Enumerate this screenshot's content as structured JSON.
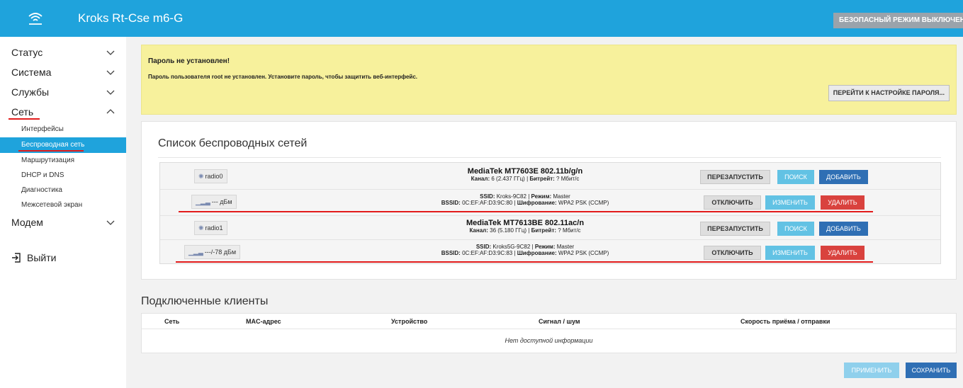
{
  "header": {
    "title": "Kroks Rt-Cse m6-G",
    "safe_mode": "БЕЗОПАСНЫЙ РЕЖИМ ВЫКЛЮЧЕН",
    "logo_icon": "wifi-signal-icon"
  },
  "sidebar": {
    "items": [
      {
        "label": "Статус",
        "icon": "chevron-down-icon"
      },
      {
        "label": "Система",
        "icon": "chevron-down-icon"
      },
      {
        "label": "Службы",
        "icon": "chevron-down-icon"
      },
      {
        "label": "Сеть",
        "icon": "chevron-up-icon"
      }
    ],
    "subitems": [
      {
        "label": "Интерфейсы"
      },
      {
        "label": "Беспроводная сеть"
      },
      {
        "label": "Маршрутизация"
      },
      {
        "label": "DHCP и DNS"
      },
      {
        "label": "Диагностика"
      },
      {
        "label": "Межсетевой экран"
      }
    ],
    "modem": {
      "label": "Модем"
    },
    "logout": {
      "label": "Выйти",
      "icon": "logout-icon"
    }
  },
  "warning": {
    "title": "Пароль не установлен!",
    "text": "Пароль пользователя root не установлен. Установите пароль, чтобы защитить веб-интерфейс.",
    "button": "ПЕРЕЙТИ К НАСТРОЙКЕ ПАРОЛЯ..."
  },
  "wireless": {
    "title": "Список беспроводных сетей",
    "devices": [
      {
        "radio_label": "radio0",
        "name": "MediaTek MT7603E 802.11b/g/n",
        "channel_label": "Канал:",
        "channel_value": "6 (2.437 ГГц)",
        "bitrate_label": "Битрейт:",
        "bitrate_value": "? Мбит/с",
        "btn_restart": "ПЕРЕЗАПУСТИТЬ",
        "btn_search": "ПОИСК",
        "btn_add": "ДОБАВИТЬ",
        "signal_label": "--- дБм",
        "ssid_label": "SSID:",
        "ssid_value": "Kroks-9C82",
        "mode_label": "Режим:",
        "mode_value": "Master",
        "bssid_label": "BSSID:",
        "bssid_value": "0C:EF:AF:D3:9C:80",
        "enc_label": "Шифрование:",
        "enc_value": "WPA2 PSK (CCMP)",
        "btn_disable": "ОТКЛЮЧИТЬ",
        "btn_edit": "ИЗМЕНИТЬ",
        "btn_delete": "УДАЛИТЬ"
      },
      {
        "radio_label": "radio1",
        "name": "MediaTek MT7613BE 802.11ac/n",
        "channel_label": "Канал:",
        "channel_value": "36 (5.180 ГГц)",
        "bitrate_label": "Битрейт:",
        "bitrate_value": "? Мбит/с",
        "btn_restart": "ПЕРЕЗАПУСТИТЬ",
        "btn_search": "ПОИСК",
        "btn_add": "ДОБАВИТЬ",
        "signal_label": "---/-78 дБм",
        "ssid_label": "SSID:",
        "ssid_value": "Kroks5G-9C82",
        "mode_label": "Режим:",
        "mode_value": "Master",
        "bssid_label": "BSSID:",
        "bssid_value": "0C:EF:AF:D3:9C:83",
        "enc_label": "Шифрование:",
        "enc_value": "WPA2 PSK (CCMP)",
        "btn_disable": "ОТКЛЮЧИТЬ",
        "btn_edit": "ИЗМЕНИТЬ",
        "btn_delete": "УДАЛИТЬ"
      }
    ]
  },
  "clients": {
    "title": "Подключенные клиенты",
    "columns": [
      "Сеть",
      "MAC-адрес",
      "Устройство",
      "Сигнал / шум",
      "Скорость приёма / отправки"
    ],
    "empty": "Нет доступной информации"
  },
  "actions": {
    "apply": "ПРИМЕНИТЬ",
    "save": "СОХРАНИТЬ"
  },
  "colors": {
    "accent": "#1fa3dc",
    "warning_bg": "#f7f19c",
    "primary": "#2f6fb4",
    "danger": "#d9423e",
    "annotation": "#e21b1b"
  }
}
